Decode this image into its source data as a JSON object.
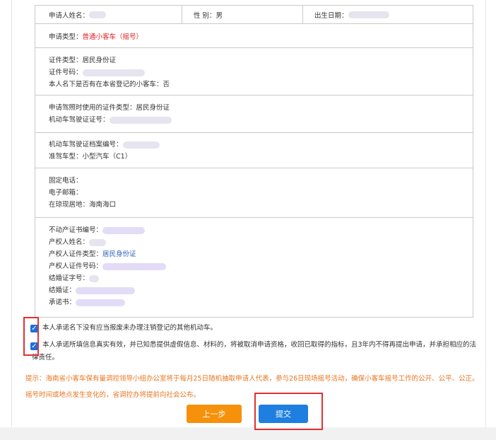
{
  "applicant": {
    "name_label": "申请人姓名：",
    "gender_label": "性  别：",
    "gender_value": "男",
    "dob_label": "出生日期："
  },
  "application": {
    "type_label": "申请类型：",
    "type_value": "普通小客车（摇号）"
  },
  "identity": {
    "cert_type_label": "证件类型：",
    "cert_type_value": "居民身份证",
    "cert_no_label": "证件号码：",
    "has_car_label": "本人名下是否有在本省登记的小客车：",
    "has_car_value": "否"
  },
  "license": {
    "cert_type_label": "申请驾照时使用的证件类型：",
    "cert_type_value": "居民身份证",
    "license_no_label": "机动车驾驶证证号："
  },
  "driving": {
    "file_no_label": "机动车驾驶证档案编号：",
    "vehicle_type_label": "准驾车型：",
    "vehicle_type_value": "小型汽车（C1）"
  },
  "contact": {
    "phone_label": "固定电话：",
    "email_label": "电子邮箱：",
    "residence_label": "在琼现居地：",
    "residence_value": "海南海口"
  },
  "property": {
    "cert_no_label": "不动产证书编号：",
    "owner_name_label": "产权人姓名：",
    "owner_cert_type_label": "产权人证件类型：",
    "owner_cert_type_value": "居民身份证",
    "owner_cert_no_label": "产权人证件号码：",
    "marriage_no_label": "结婚证字号：",
    "marriage_cert_label": "结婚证：",
    "promise_label": "承诺书："
  },
  "checks": {
    "c1": "本人承诺名下没有应当报废未办理注销登记的其他机动车。",
    "c2_line1": "本人承诺所填信息真实有效，并已知悉提供虚假信息、材料的，将被取消申请资格，收回已取得的指标，且3年内不得再提出申请，并承担相应的法",
    "c2_line2": "律责任。"
  },
  "tip": {
    "line1": "提示：海南省小客车保有量调控领导小组办公室将于每月25日随机抽取申请人代表，参与26日现场摇号活动，确保小客车摇号工作的公开、公平、公正。",
    "line2": "摇号时间或地点发生变化的，省调控办将提前向社会公布。"
  },
  "buttons": {
    "prev": "上一步",
    "submit": "提交"
  },
  "colors": {
    "checkbox": "#1e6fd9",
    "prev_button": "#f5910a",
    "submit_button": "#1e7fe0",
    "highlight": "#e03131",
    "tip": "#e8741e"
  }
}
